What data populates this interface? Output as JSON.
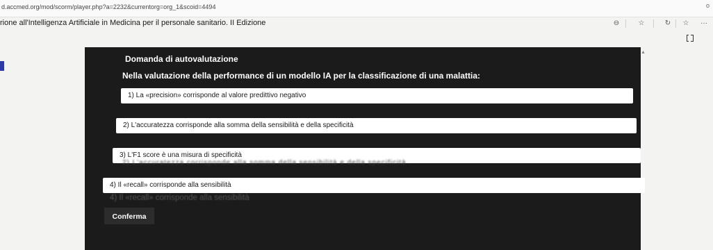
{
  "browser": {
    "url": "d.accmed.org/mod/scorm/player.php?a=2232&currentorg=org_1&scoid=4494",
    "minimize": "–",
    "close": "o"
  },
  "page": {
    "title": "rione all'Intelligenza Artificiale in Medicina per il personale sanitario. II Edizione",
    "more": "···"
  },
  "quiz": {
    "heading": "Domanda di autovalutazione",
    "question": "Nella valutazione della performance di un modello IA per la classificazione di una malattia:",
    "options": [
      "1) La «precision» corrisponde al valore predittivo negativo",
      "2) L'accuratezza corrisponde alla somma della sensibilità e della specificità",
      "3) L'F1 score è una misura di specificità",
      "4) Il «recall» corrisponde alla sensibilità"
    ],
    "ghost_text": "2) L'accuratezza corrisponde alla somma della sensibilità e della specificità",
    "ghost_text_big": "4) Il «recall» corrisponde alla sensibilità",
    "confirm_label": "Conferma"
  }
}
